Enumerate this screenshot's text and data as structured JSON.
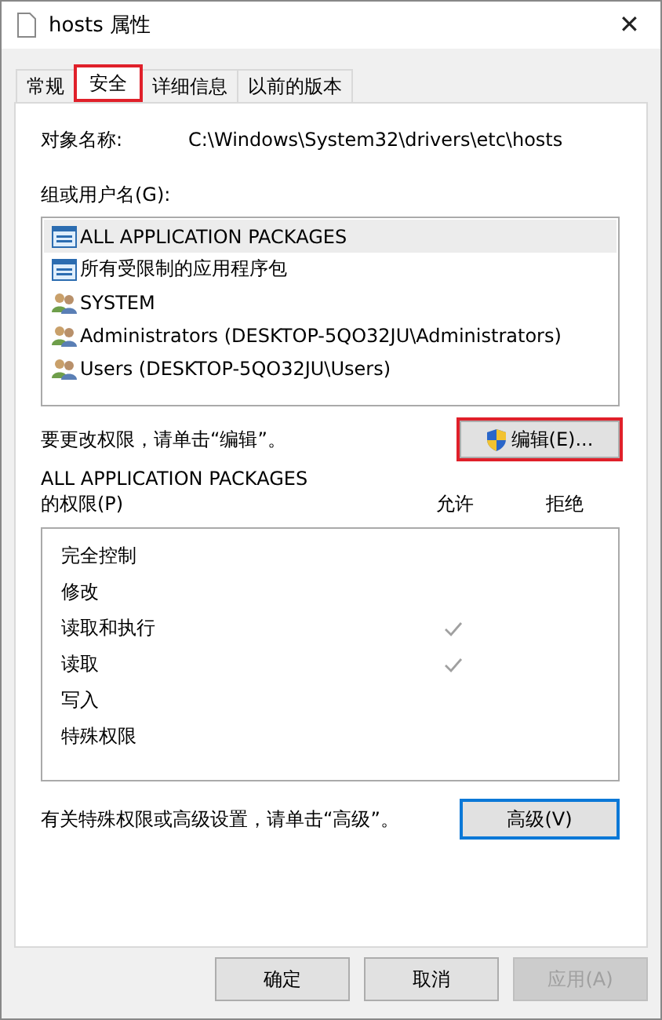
{
  "window": {
    "title": "hosts 属性",
    "close": "✕"
  },
  "tabs": [
    {
      "label": "常规",
      "selected": false,
      "marked": false
    },
    {
      "label": "安全",
      "selected": true,
      "marked": true
    },
    {
      "label": "详细信息",
      "selected": false,
      "marked": false
    },
    {
      "label": "以前的版本",
      "selected": false,
      "marked": false
    }
  ],
  "object_name": {
    "label": "对象名称:",
    "value": "C:\\Windows\\System32\\drivers\\etc\\hosts"
  },
  "groups": {
    "label": "组或用户名(G):",
    "items": [
      {
        "kind": "package",
        "name": "ALL APPLICATION PACKAGES",
        "selected": true
      },
      {
        "kind": "package",
        "name": "所有受限制的应用程序包",
        "selected": false
      },
      {
        "kind": "group",
        "name": "SYSTEM",
        "selected": false
      },
      {
        "kind": "group",
        "name": "Administrators (DESKTOP-5QO32JU\\Administrators)",
        "selected": false
      },
      {
        "kind": "group",
        "name": "Users (DESKTOP-5QO32JU\\Users)",
        "selected": false
      }
    ]
  },
  "edit_hint": "要更改权限，请单击“编辑”。",
  "edit_button": {
    "label": "编辑(E)...",
    "marked": true
  },
  "permissions": {
    "subject": "ALL APPLICATION PACKAGES",
    "label": "的权限(P)",
    "allow_heading": "允许",
    "deny_heading": "拒绝",
    "rows": [
      {
        "name": "完全控制",
        "allow": false,
        "deny": false
      },
      {
        "name": "修改",
        "allow": false,
        "deny": false
      },
      {
        "name": "读取和执行",
        "allow": true,
        "deny": false
      },
      {
        "name": "读取",
        "allow": true,
        "deny": false
      },
      {
        "name": "写入",
        "allow": false,
        "deny": false
      },
      {
        "name": "特殊权限",
        "allow": false,
        "deny": false
      }
    ]
  },
  "advanced_hint": "有关特殊权限或高级设置，请单击“高级”。",
  "advanced_button": {
    "label": "高级(V)"
  },
  "buttons": [
    {
      "label": "确定",
      "disabled": false
    },
    {
      "label": "取消",
      "disabled": false
    },
    {
      "label": "应用(A)",
      "disabled": true
    }
  ]
}
